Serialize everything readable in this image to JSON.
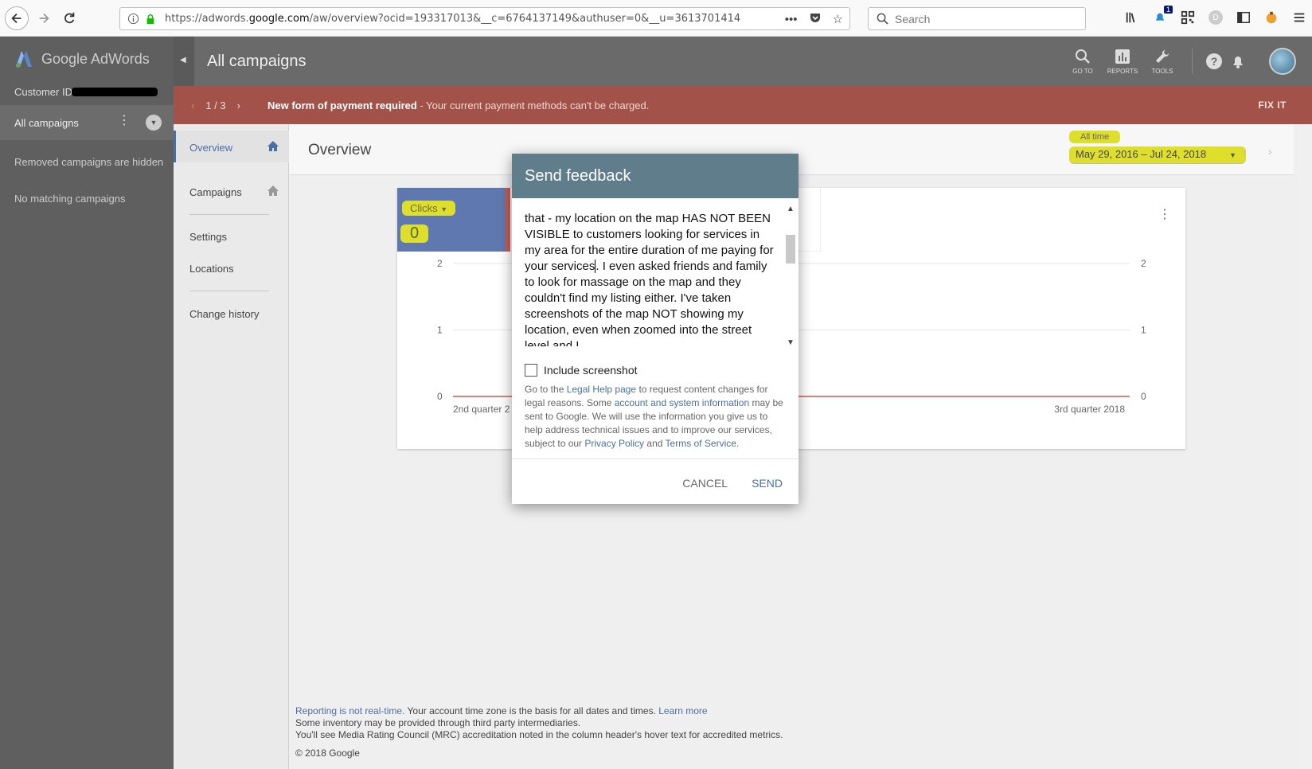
{
  "browser": {
    "url_prefix": "https://adwords.",
    "url_host": "google.com",
    "url_path": "/aw/overview?ocid=193317013&__c=6764137149&authuser=0&__u=3613701414",
    "search_placeholder": "Search",
    "notification_count": "1",
    "extension_letter": "D"
  },
  "sidebar": {
    "brand": "Google AdWords",
    "customer_id_label": "Customer ID:",
    "all_campaigns": "All campaigns",
    "removed_hidden": "Removed campaigns are hidden",
    "no_matching": "No matching campaigns"
  },
  "header": {
    "title": "All campaigns",
    "tools": [
      {
        "label": "GO TO",
        "icon": "search-icon"
      },
      {
        "label": "REPORTS",
        "icon": "bar-chart-icon"
      },
      {
        "label": "TOOLS",
        "icon": "wrench-icon"
      }
    ]
  },
  "alert": {
    "pager": "1 / 3",
    "title": "New form of payment required",
    "message": " - Your current payment methods can't be charged.",
    "action": "FIX IT"
  },
  "subnav": {
    "items": [
      "Overview",
      "Campaigns",
      "Settings",
      "Locations",
      "Change history"
    ],
    "active": "Overview"
  },
  "overview": {
    "title": "Overview",
    "date_label": "All time",
    "date_range": "May 29, 2016 – Jul 24, 2018"
  },
  "chart_data": {
    "type": "line",
    "metric": "Clicks",
    "metric_value": "0",
    "categories": [
      "2nd quarter 2",
      "3rd quarter 2018"
    ],
    "series": [
      {
        "values": [
          0,
          0
        ]
      }
    ],
    "yticks": [
      "2",
      "1",
      "0"
    ],
    "ylim": [
      0,
      2
    ],
    "colors": {
      "line": "#c95b50",
      "clicks_tile": "#5f79b0"
    }
  },
  "footer": {
    "realtime_link": "Reporting is not real-time.",
    "timezone_text": " Your account time zone is the basis for all dates and times. ",
    "learn_more": "Learn more",
    "inventory": "Some inventory may be provided through third party intermediaries.",
    "mrc": "You'll see Media Rating Council (MRC) accreditation noted in the column header's hover text for accredited metrics.",
    "copyright": "© 2018 Google"
  },
  "modal": {
    "title": "Send feedback",
    "text_before_cursor": "that - my location on the map HAS NOT BEEN VISIBLE to customers looking for services in my area for the entire duration of me paying for your services",
    "text_after_cursor": ". I even asked friends and family to look for massage on the map and they couldn't find my listing either. I've taken screenshots of the map NOT showing my location, even when zoomed into the street level and I",
    "include_screenshot": "Include screenshot",
    "legal_1": "Go to the ",
    "legal_link_1": "Legal Help page",
    "legal_2": " to request content changes for legal reasons. Some ",
    "legal_link_2": "account and system information",
    "legal_3": " may be sent to Google. We will use the information you give us to help address technical issues and to improve our services, subject to our ",
    "legal_link_3": "Privacy Policy",
    "legal_4": " and ",
    "legal_link_4": "Terms of Service",
    "legal_5": ".",
    "cancel": "CANCEL",
    "send": "SEND"
  }
}
